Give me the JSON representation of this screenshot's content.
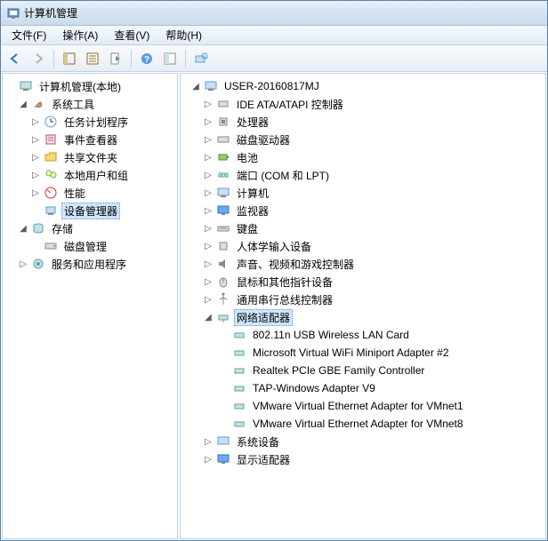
{
  "window": {
    "title": "计算机管理"
  },
  "menu": {
    "file": "文件(F)",
    "action": "操作(A)",
    "view": "查看(V)",
    "help": "帮助(H)"
  },
  "left_tree": {
    "root": "计算机管理(本地)",
    "system_tools": "系统工具",
    "task_scheduler": "任务计划程序",
    "event_viewer": "事件查看器",
    "shared_folders": "共享文件夹",
    "local_users": "本地用户和组",
    "performance": "性能",
    "device_manager": "设备管理器",
    "storage": "存储",
    "disk_mgmt": "磁盘管理",
    "services_apps": "服务和应用程序"
  },
  "right_tree": {
    "root": "USER-20160817MJ",
    "ide": "IDE ATA/ATAPI 控制器",
    "cpu": "处理器",
    "disk_drives": "磁盘驱动器",
    "battery": "电池",
    "ports": "端口 (COM 和 LPT)",
    "computer": "计算机",
    "monitors": "监视器",
    "keyboards": "键盘",
    "hid": "人体学输入设备",
    "sound": "声音、视频和游戏控制器",
    "mouse": "鼠标和其他指针设备",
    "usb": "通用串行总线控制器",
    "network": "网络适配器",
    "net1": "802.11n USB Wireless LAN Card",
    "net2": "Microsoft Virtual WiFi Miniport Adapter #2",
    "net3": "Realtek PCIe GBE Family Controller",
    "net4": "TAP-Windows Adapter V9",
    "net5": "VMware Virtual Ethernet Adapter for VMnet1",
    "net6": "VMware Virtual Ethernet Adapter for VMnet8",
    "system_devices": "系统设备",
    "display": "显示适配器"
  }
}
